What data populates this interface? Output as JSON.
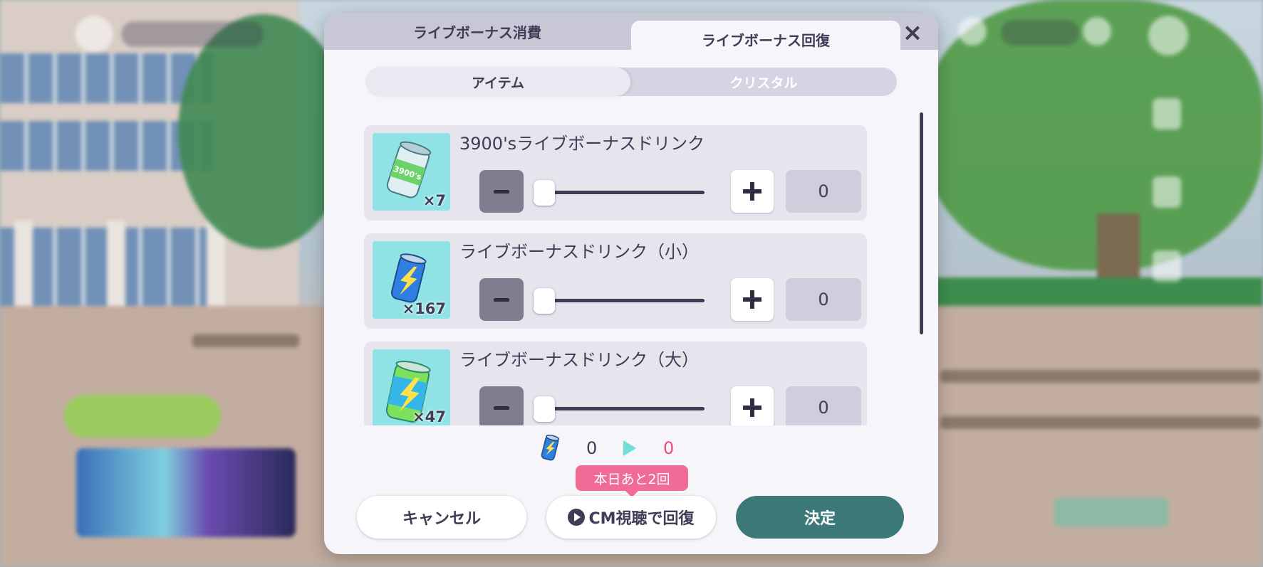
{
  "dialog": {
    "tabs": [
      {
        "label": "ライブボーナス消費",
        "active": false
      },
      {
        "label": "ライブボーナス回復",
        "active": true
      }
    ],
    "close_icon": "×",
    "segments": [
      {
        "label": "アイテム",
        "active": true
      },
      {
        "label": "クリスタル",
        "active": false
      }
    ],
    "items": [
      {
        "name": "3900'sライブボーナスドリンク",
        "owned": "×7",
        "quantity": "0",
        "icon": "drink-3900s-icon",
        "can_text": "3900's"
      },
      {
        "name": "ライブボーナスドリンク（小）",
        "owned": "×167",
        "quantity": "0",
        "icon": "drink-small-icon"
      },
      {
        "name": "ライブボーナスドリンク（大）",
        "owned": "×47",
        "quantity": "0",
        "icon": "drink-large-icon"
      }
    ],
    "summary": {
      "before": "0",
      "after": "0"
    },
    "tooltip": "本日あと2回",
    "buttons": {
      "cancel": "キャンセル",
      "cm": "CM視聴で回復",
      "ok": "決定"
    }
  },
  "colors": {
    "accent_teal": "#3c7877",
    "pink": "#f06b96",
    "text": "#3f3d56",
    "thumb_bg": "#8fe3e5"
  }
}
